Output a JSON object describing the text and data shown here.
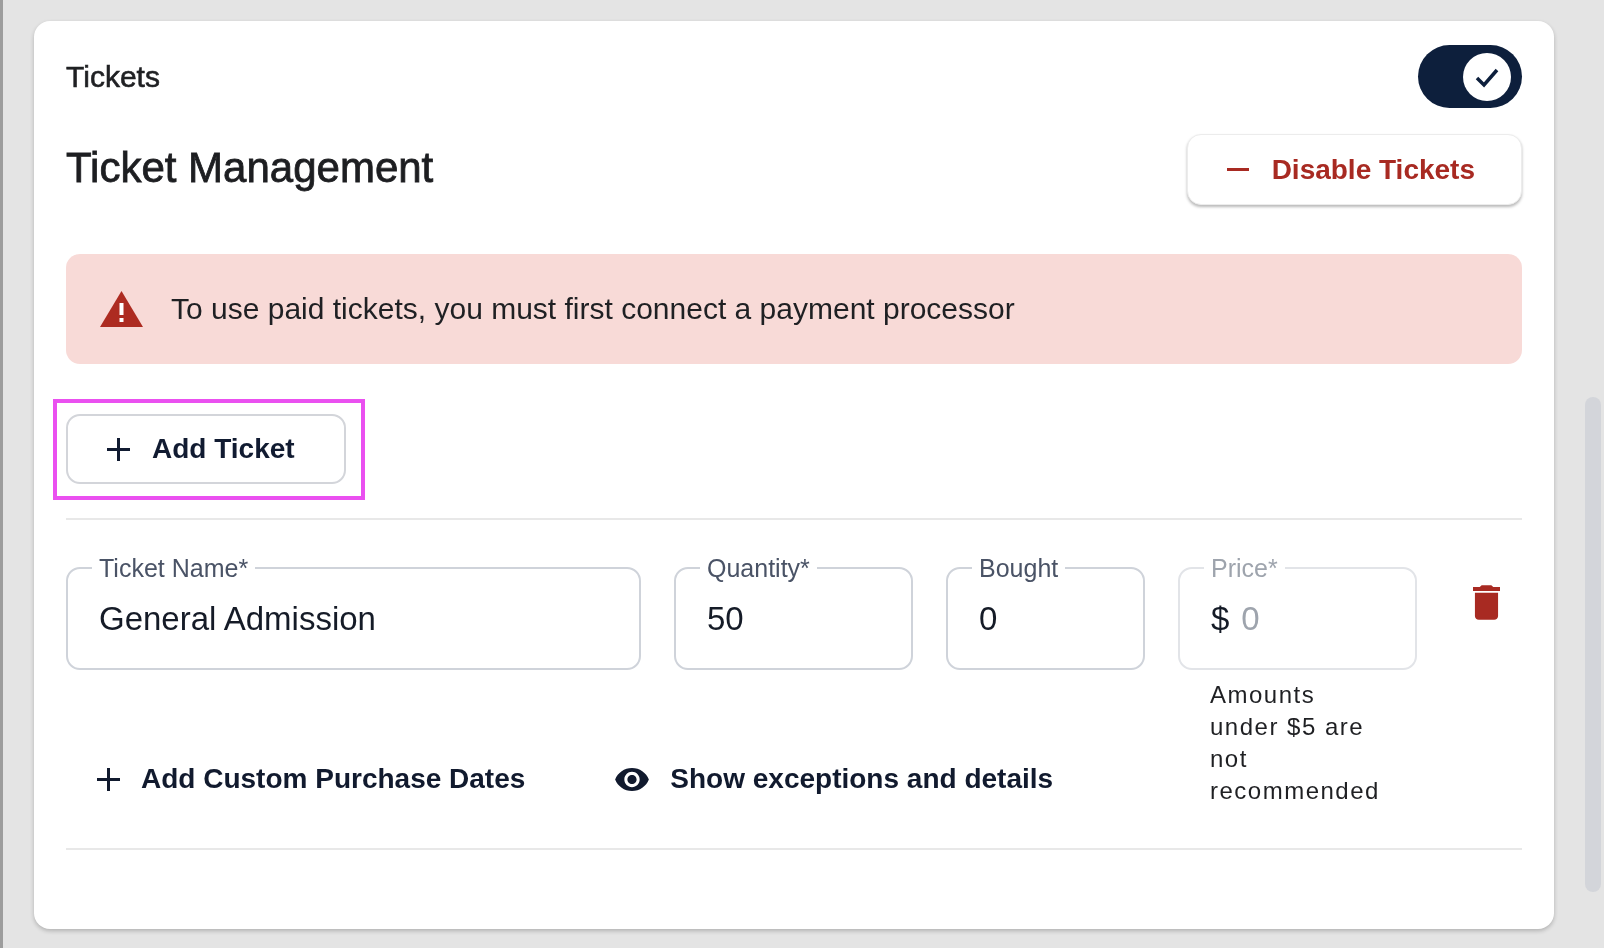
{
  "section": {
    "title": "Tickets",
    "enabled": true
  },
  "header": {
    "title": "Ticket Management",
    "disable_button": {
      "label": "Disable Tickets"
    }
  },
  "alert": {
    "message": "To use paid tickets, you must first connect a payment processor"
  },
  "add_ticket_button": {
    "label": "Add Ticket",
    "highlighted": true
  },
  "tickets": [
    {
      "fields": [
        {
          "kind": "text",
          "label": "Ticket Name*",
          "value": "General Admission",
          "disabled": false
        },
        {
          "kind": "number",
          "label": "Quantity*",
          "value": "50",
          "disabled": false
        },
        {
          "kind": "number",
          "label": "Bought",
          "value": "0",
          "disabled": false
        },
        {
          "kind": "currency",
          "label": "Price*",
          "prefix": "$",
          "placeholder": "0",
          "disabled": true,
          "helper": "Amounts under $5 are not recommended"
        }
      ],
      "actions": [
        {
          "kind": "add",
          "label": "Add Custom Purchase Dates"
        },
        {
          "kind": "view",
          "label": "Show exceptions and details"
        }
      ]
    }
  ]
}
